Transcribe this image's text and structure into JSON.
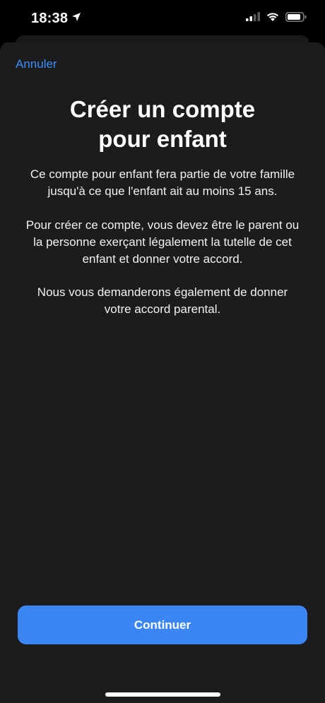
{
  "status_bar": {
    "time": "18:38",
    "icons": [
      "location-arrow-icon",
      "cellular-signal-icon",
      "wifi-icon",
      "battery-icon"
    ]
  },
  "nav": {
    "cancel_label": "Annuler"
  },
  "content": {
    "title_line1": "Créer un compte",
    "title_line2": "pour enfant",
    "paragraph1": [
      "Ce compte pour enfant fera partie de votre famille",
      "jusqu'à ce que l'enfant ait au moins 15 ans."
    ],
    "paragraph2": [
      "Pour créer ce compte, vous devez être le parent ou",
      "la personne exerçant légalement la tutelle de cet",
      "enfant et donner votre accord."
    ],
    "paragraph3": [
      "Nous vous demanderons également de donner",
      "votre accord parental."
    ]
  },
  "footer": {
    "continue_label": "Continuer"
  },
  "colors": {
    "accent": "#3a86f5",
    "link": "#3d8ef8",
    "sheet_background": "#1c1c1e",
    "background": "#000000"
  }
}
